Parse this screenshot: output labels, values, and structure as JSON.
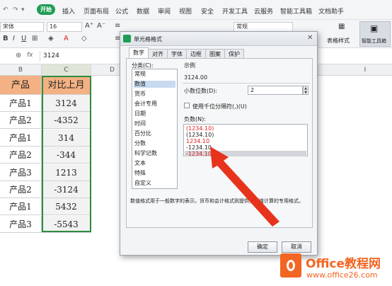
{
  "menu": {
    "items": [
      "插入",
      "页面布局",
      "公式",
      "数据",
      "审阅",
      "视图",
      "安全",
      "开发工具",
      "云服务",
      "智能工具箱",
      "文档助手"
    ],
    "active_tab": "开始"
  },
  "toolbar": {
    "font_name": "宋体",
    "font_size": "16",
    "number_format": "常规",
    "table_style_label": "表格样式",
    "smart_toolbox_label": "智能工具箱"
  },
  "formula_bar": {
    "fx_label": "fx",
    "value": "3124"
  },
  "columns": {
    "headers": [
      "B",
      "C",
      "D",
      "I"
    ]
  },
  "sheet": {
    "header_row": {
      "product": "产品",
      "compare": "对比上月"
    },
    "rows": [
      {
        "product": "产品1",
        "value": "3124"
      },
      {
        "product": "产品2",
        "value": "-4352"
      },
      {
        "product": "产品1",
        "value": "314"
      },
      {
        "product": "产品2",
        "value": "-344"
      },
      {
        "product": "产品3",
        "value": "1213"
      },
      {
        "product": "产品2",
        "value": "-3124"
      },
      {
        "product": "产品1",
        "value": "5432"
      },
      {
        "product": "产品3",
        "value": "-5543"
      }
    ]
  },
  "dialog": {
    "title": "单元格格式",
    "tabs": [
      "数字",
      "对齐",
      "字体",
      "边框",
      "图案",
      "保护"
    ],
    "category_label": "分类(C):",
    "categories": [
      "常规",
      "数值",
      "货币",
      "会计专用",
      "日期",
      "时间",
      "百分比",
      "分数",
      "科学记数",
      "文本",
      "特殊",
      "自定义"
    ],
    "selected_category": "数值",
    "sample_label": "示例",
    "sample_value": "3124.00",
    "decimal_label": "小数位数(D):",
    "decimal_value": "2",
    "thousands_label": "使用千位分隔符(,)(U)",
    "negative_label": "负数(N):",
    "negative_formats": [
      "(1234.10)",
      "(1234.10)",
      "1234.10",
      "-1234.10",
      "-1234.10"
    ],
    "negative_colors": [
      "#e02020",
      "#222222",
      "#e02020",
      "#222222",
      "#e02020"
    ],
    "description": "数值格式用于一般数字的表示。货币和会计格式则提供货币值计算的专用格式。",
    "ok_label": "确定",
    "cancel_label": "取消"
  },
  "watermark": {
    "brand": "Office教程网",
    "url": "www.office26.com"
  },
  "colors": {
    "accent_green": "#1e9c55",
    "header_fill": "#f4b183",
    "arrow_red": "#e8331c",
    "watermark_orange": "#f26522"
  }
}
